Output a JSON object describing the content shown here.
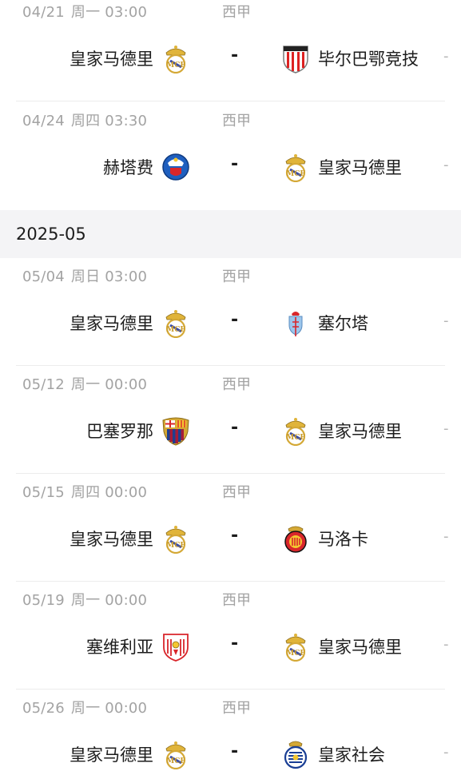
{
  "months": [
    {
      "label": "2025-05"
    }
  ],
  "matches": [
    {
      "date": "04/21",
      "weekday": "周一",
      "time": "03:00",
      "league": "西甲",
      "home": "皇家马德里",
      "home_logo": "real-madrid",
      "away": "毕尔巴鄂竞技",
      "away_logo": "athletic-bilbao",
      "vs": "-",
      "score": "-"
    },
    {
      "date": "04/24",
      "weekday": "周四",
      "time": "03:30",
      "league": "西甲",
      "home": "赫塔费",
      "home_logo": "getafe",
      "away": "皇家马德里",
      "away_logo": "real-madrid",
      "vs": "-",
      "score": "-"
    },
    {
      "date": "05/04",
      "weekday": "周日",
      "time": "03:00",
      "league": "西甲",
      "home": "皇家马德里",
      "home_logo": "real-madrid",
      "away": "塞尔塔",
      "away_logo": "celta",
      "vs": "-",
      "score": "-"
    },
    {
      "date": "05/12",
      "weekday": "周一",
      "time": "00:00",
      "league": "西甲",
      "home": "巴塞罗那",
      "home_logo": "barcelona",
      "away": "皇家马德里",
      "away_logo": "real-madrid",
      "vs": "-",
      "score": "-"
    },
    {
      "date": "05/15",
      "weekday": "周四",
      "time": "00:00",
      "league": "西甲",
      "home": "皇家马德里",
      "home_logo": "real-madrid",
      "away": "马洛卡",
      "away_logo": "mallorca",
      "vs": "-",
      "score": "-"
    },
    {
      "date": "05/19",
      "weekday": "周一",
      "time": "00:00",
      "league": "西甲",
      "home": "塞维利亚",
      "home_logo": "sevilla",
      "away": "皇家马德里",
      "away_logo": "real-madrid",
      "vs": "-",
      "score": "-"
    },
    {
      "date": "05/26",
      "weekday": "周一",
      "time": "00:00",
      "league": "西甲",
      "home": "皇家马德里",
      "home_logo": "real-madrid",
      "away": "皇家社会",
      "away_logo": "real-sociedad",
      "vs": "-",
      "score": "-"
    }
  ],
  "colors": {
    "text_primary": "#1c1c1c",
    "text_secondary": "#a3a3a3",
    "section_bg": "#f4f4f6",
    "divider": "#ececec"
  }
}
